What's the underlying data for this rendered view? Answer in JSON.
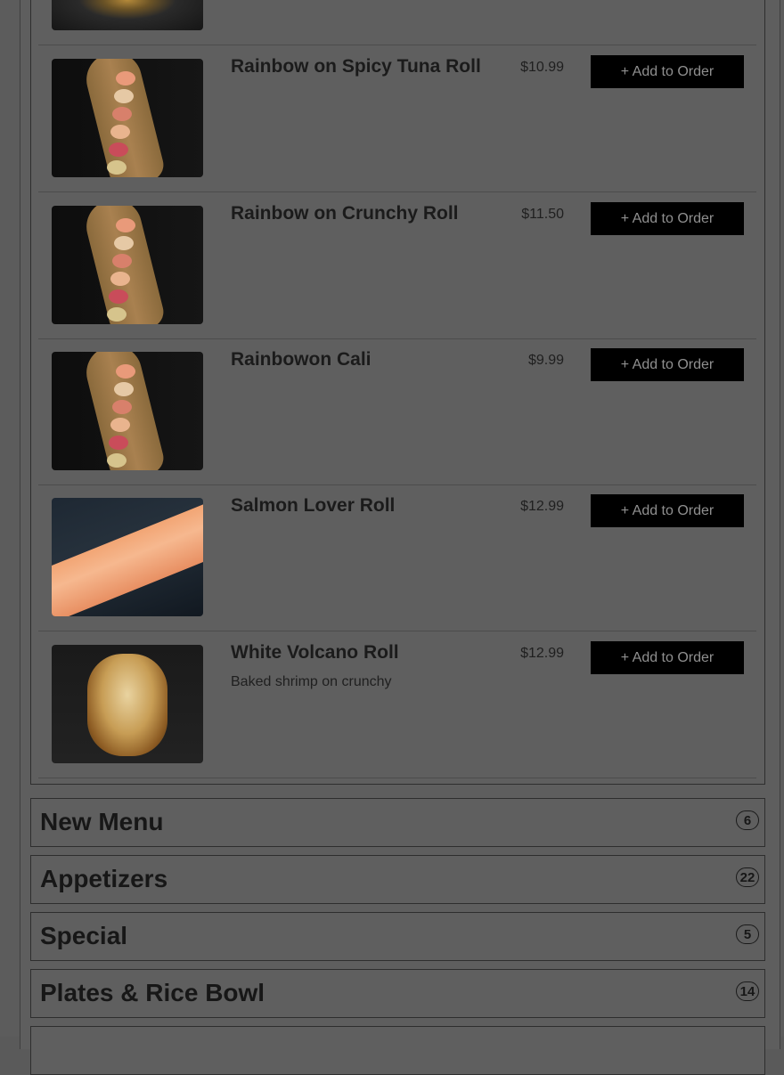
{
  "menu": {
    "add_to_order_label": "+ Add to Order",
    "items": [
      {
        "name": "Rainbow on Spicy Tuna Roll",
        "price": "$10.99",
        "description": "",
        "image": "rainbow-roll-photo"
      },
      {
        "name": "Rainbow on Crunchy Roll",
        "price": "$11.50",
        "description": "",
        "image": "rainbow-roll-photo"
      },
      {
        "name": "Rainbowon Cali",
        "price": "$9.99",
        "description": "",
        "image": "rainbow-roll-photo"
      },
      {
        "name": "Salmon Lover Roll",
        "price": "$12.99",
        "description": "",
        "image": "salmon-roll-photo"
      },
      {
        "name": "White Volcano Roll",
        "price": "$12.99",
        "description": "Baked shrimp on crunchy",
        "image": "volcano-roll-photo"
      }
    ]
  },
  "categories": [
    {
      "title": "New Menu",
      "count": "6"
    },
    {
      "title": "Appetizers",
      "count": "22"
    },
    {
      "title": "Special",
      "count": "5"
    },
    {
      "title": "Plates & Rice Bowl",
      "count": "14"
    },
    {
      "title": "",
      "count": ""
    }
  ],
  "colors": {
    "overlay": "#5e5e5e",
    "button_bg": "#000000",
    "button_text": "#8f8f8f"
  }
}
